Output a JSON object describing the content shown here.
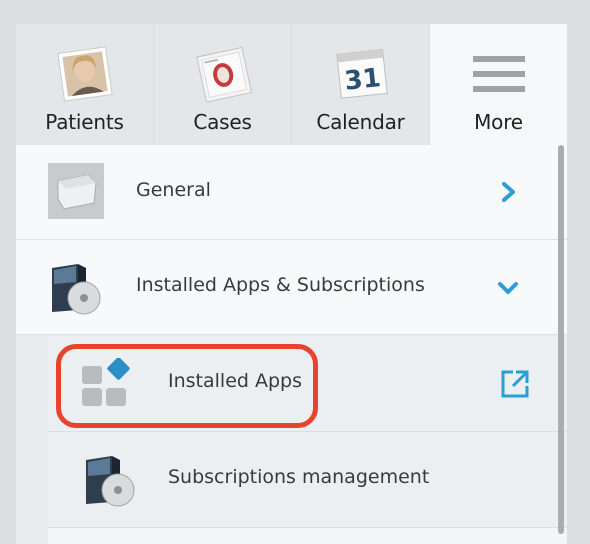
{
  "tabs": [
    {
      "label": "Patients",
      "icon": "patient-photo-icon"
    },
    {
      "label": "Cases",
      "icon": "case-folder-icon"
    },
    {
      "label": "Calendar",
      "icon": "calendar-icon",
      "icon_text": "31"
    },
    {
      "label": "More",
      "icon": "hamburger-menu-icon"
    }
  ],
  "menu": {
    "general": {
      "label": "General",
      "icon": "general-box-icon",
      "action_icon": "chevron-right-icon"
    },
    "installed_apps_subscriptions": {
      "label": "Installed Apps & Subscriptions",
      "icon": "software-box-icon",
      "action_icon": "chevron-down-icon"
    },
    "installed_apps": {
      "label": "Installed Apps",
      "icon": "apps-grid-icon",
      "action_icon": "external-link-icon"
    },
    "subscriptions_management": {
      "label": "Subscriptions management",
      "icon": "software-box-icon"
    }
  },
  "colors": {
    "accent": "#2a9fd6",
    "highlight": "#e8432d"
  }
}
